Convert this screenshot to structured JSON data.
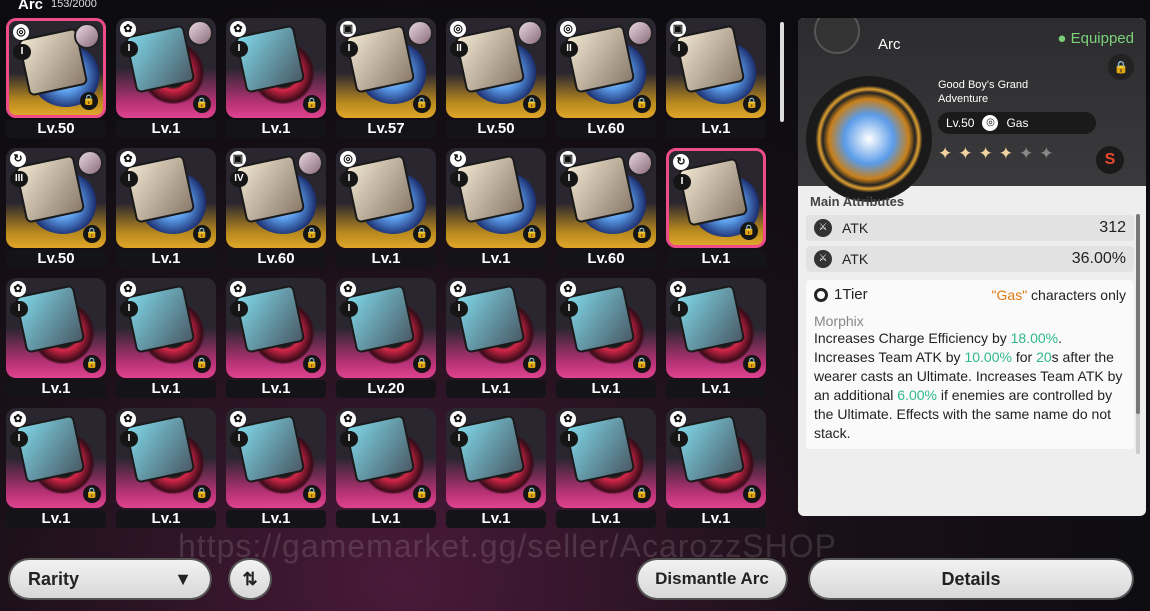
{
  "header": {
    "title": "Arc",
    "count": "153/2000"
  },
  "items": [
    {
      "level": "Lv.50",
      "tier": "I",
      "rarity": "gold",
      "selected": true,
      "avatar": true,
      "icon": "swirl"
    },
    {
      "level": "Lv.1",
      "tier": "I",
      "rarity": "pink",
      "avatar": true,
      "icon": "gear"
    },
    {
      "level": "Lv.1",
      "tier": "I",
      "rarity": "pink",
      "icon": "gear"
    },
    {
      "level": "Lv.57",
      "tier": "I",
      "rarity": "gold",
      "avatar": true,
      "icon": "cube"
    },
    {
      "level": "Lv.50",
      "tier": "II",
      "rarity": "gold",
      "avatar": true,
      "icon": "swirl"
    },
    {
      "level": "Lv.60",
      "tier": "II",
      "rarity": "gold",
      "avatar": true,
      "icon": "swirl"
    },
    {
      "level": "Lv.1",
      "tier": "I",
      "rarity": "gold",
      "icon": "cube"
    },
    {
      "level": "Lv.50",
      "tier": "III",
      "rarity": "gold",
      "avatar": true,
      "icon": "bolt"
    },
    {
      "level": "Lv.1",
      "tier": "I",
      "rarity": "gold",
      "icon": "gear"
    },
    {
      "level": "Lv.60",
      "tier": "IV",
      "rarity": "gold",
      "avatar": true,
      "icon": "cube"
    },
    {
      "level": "Lv.1",
      "tier": "I",
      "rarity": "gold",
      "icon": "swirl"
    },
    {
      "level": "Lv.1",
      "tier": "I",
      "rarity": "gold",
      "icon": "bolt"
    },
    {
      "level": "Lv.60",
      "tier": "I",
      "rarity": "gold",
      "avatar": true,
      "icon": "cube"
    },
    {
      "level": "Lv.1",
      "tier": "I",
      "rarity": "gold",
      "selected": true,
      "icon": "bolt"
    },
    {
      "level": "Lv.1",
      "tier": "I",
      "rarity": "pink",
      "icon": "gear"
    },
    {
      "level": "Lv.1",
      "tier": "I",
      "rarity": "pink",
      "icon": "gear"
    },
    {
      "level": "Lv.1",
      "tier": "I",
      "rarity": "pink",
      "icon": "gear"
    },
    {
      "level": "Lv.20",
      "tier": "I",
      "rarity": "pink",
      "icon": "gear"
    },
    {
      "level": "Lv.1",
      "tier": "I",
      "rarity": "pink",
      "icon": "gear"
    },
    {
      "level": "Lv.1",
      "tier": "I",
      "rarity": "pink",
      "icon": "gear"
    },
    {
      "level": "Lv.1",
      "tier": "I",
      "rarity": "pink",
      "icon": "gear"
    },
    {
      "level": "Lv.1",
      "tier": "I",
      "rarity": "pink",
      "icon": "gear"
    },
    {
      "level": "Lv.1",
      "tier": "I",
      "rarity": "pink",
      "icon": "gear"
    },
    {
      "level": "Lv.1",
      "tier": "I",
      "rarity": "pink",
      "icon": "gear"
    },
    {
      "level": "Lv.1",
      "tier": "I",
      "rarity": "pink",
      "icon": "gear"
    },
    {
      "level": "Lv.1",
      "tier": "I",
      "rarity": "pink",
      "icon": "gear"
    },
    {
      "level": "Lv.1",
      "tier": "I",
      "rarity": "pink",
      "icon": "gear"
    },
    {
      "level": "Lv.1",
      "tier": "I",
      "rarity": "pink",
      "icon": "gear"
    }
  ],
  "detail": {
    "title": "Arc",
    "status": "Equipped",
    "name": "Good Boy's Grand Adventure",
    "level": "Lv.50",
    "element": "Gas",
    "stars_filled": 4,
    "stars_total": 6,
    "main_attributes_label": "Main Attributes",
    "attributes": [
      {
        "name": "ATK",
        "value": "312"
      },
      {
        "name": "ATK",
        "value": "36.00%"
      }
    ],
    "tier_label": "1Tier",
    "restriction_quote": "\"Gas\"",
    "restriction_text": " characters only",
    "skill_name": "Morphix",
    "desc": {
      "p1": "Increases Charge Efficiency by ",
      "v1": "18.00%",
      "p2": ". Increases Team ATK by ",
      "v2": "10.00%",
      "p3": " for ",
      "v3": "20",
      "p4": "s after the wearer casts an Ultimate. Increases Team ATK by an additional ",
      "v4": "6.00%",
      "p5": " if enemies are controlled by the Ultimate. Effects with the same name do not stack."
    }
  },
  "footer": {
    "sort_label": "Rarity",
    "dismantle_label": "Dismantle Arc",
    "details_label": "Details"
  },
  "watermark": "https://gamemarket.gg/seller/AcarozzSHOP",
  "colors": {
    "accent_pink": "#ef4d8a",
    "equipped_green": "#7bd17b",
    "gold": "#e0a62a",
    "highlight_green": "#2fb98a",
    "highlight_orange": "#e07a12"
  }
}
